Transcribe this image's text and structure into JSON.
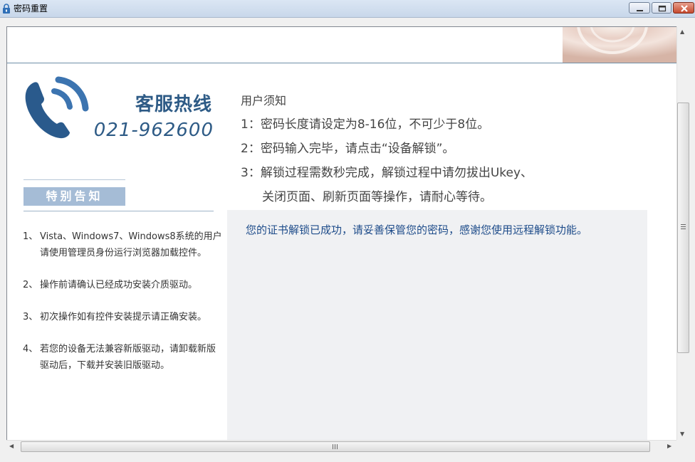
{
  "window": {
    "title": "密码重置"
  },
  "hotline": {
    "title": "客服热线",
    "number": "021-962600"
  },
  "special_notice": {
    "heading": "特别告知",
    "items": [
      {
        "num": "1、",
        "text": "Vista、Windows7、Windows8系统的用户请使用管理员身份运行浏览器加载控件。"
      },
      {
        "num": "2、",
        "text": "操作前请确认已经成功安装介质驱动。"
      },
      {
        "num": "3、",
        "text": "初次操作如有控件安装提示请正确安装。"
      },
      {
        "num": "4、",
        "text": "若您的设备无法兼容新版驱动，请卸载新版驱动后，下载并安装旧版驱动。"
      }
    ]
  },
  "user_notice": {
    "title": "用户须知",
    "steps": [
      "1：密码长度请设定为8-16位，不可少于8位。",
      "2：密码输入完毕，请点击“设备解锁”。",
      "3：解锁过程需数秒完成，解锁过程中请勿拔出Ukey、",
      "关闭页面、刷新页面等操作，请耐心等待。"
    ]
  },
  "status": {
    "message": "您的证书解锁已成功，请妥善保管您的密码，感谢您使用远程解锁功能。"
  },
  "colors": {
    "accent": "#2e5b86",
    "notice_bg": "#a5bcd6",
    "message": "#1e4c8a"
  },
  "icons": [
    "lock-icon",
    "minimize-icon",
    "maximize-icon",
    "close-icon",
    "phone-icon"
  ]
}
